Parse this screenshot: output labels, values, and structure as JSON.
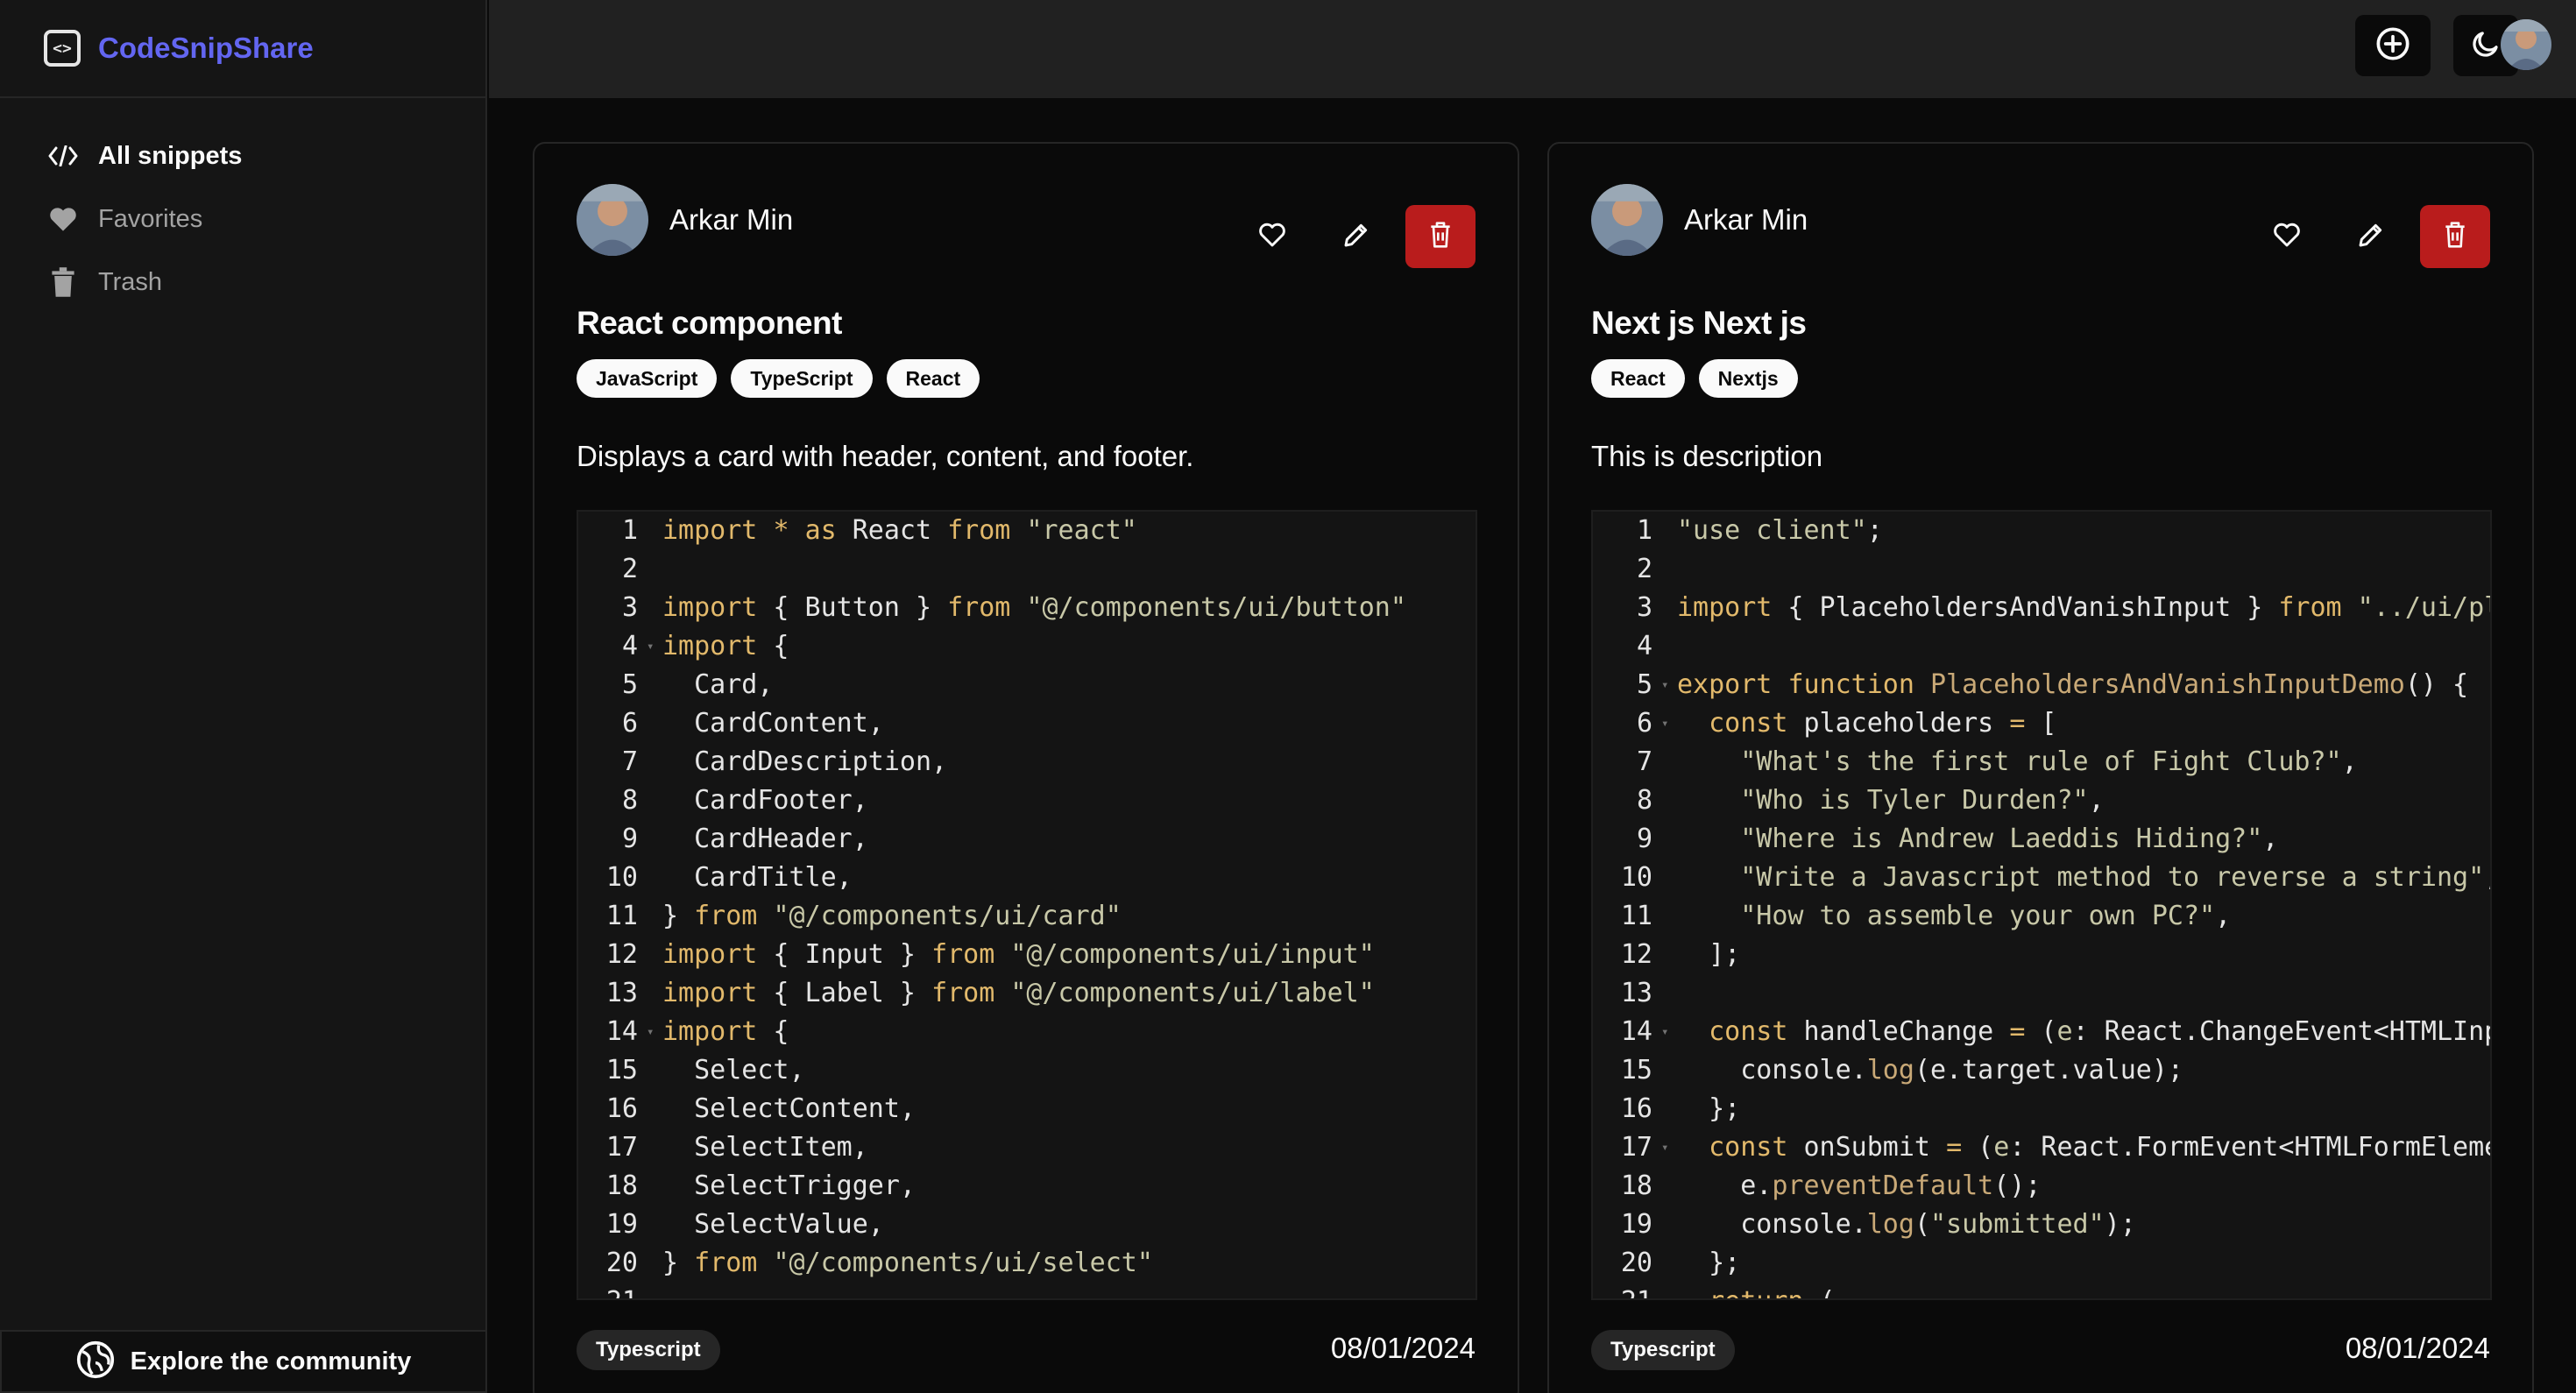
{
  "app": {
    "name": "CodeSnipShare"
  },
  "sidebar": {
    "items": [
      {
        "label": "All snippets",
        "icon": "code-icon",
        "active": true
      },
      {
        "label": "Favorites",
        "icon": "heart-icon",
        "active": false
      },
      {
        "label": "Trash",
        "icon": "trash-icon",
        "active": false
      }
    ],
    "explore_label": "Explore the community"
  },
  "topbar": {
    "buttons": [
      "add-snippet-icon",
      "theme-toggle-icon",
      "user-avatar"
    ]
  },
  "colors": {
    "brand": "#6366f1",
    "delete": "#b91c1c",
    "background": "#0a0a0a"
  },
  "snippets": [
    {
      "author": "Arkar Min",
      "title": "React component",
      "tags": [
        "JavaScript",
        "TypeScript",
        "React"
      ],
      "description": "Displays a card with header, content, and footer.",
      "language": "Typescript",
      "date": "08/01/2024"
    },
    {
      "author": "Arkar Min",
      "title": "Next js Next js",
      "tags": [
        "React",
        "Nextjs"
      ],
      "description": "This is description",
      "language": "Typescript",
      "date": "08/01/2024"
    }
  ]
}
